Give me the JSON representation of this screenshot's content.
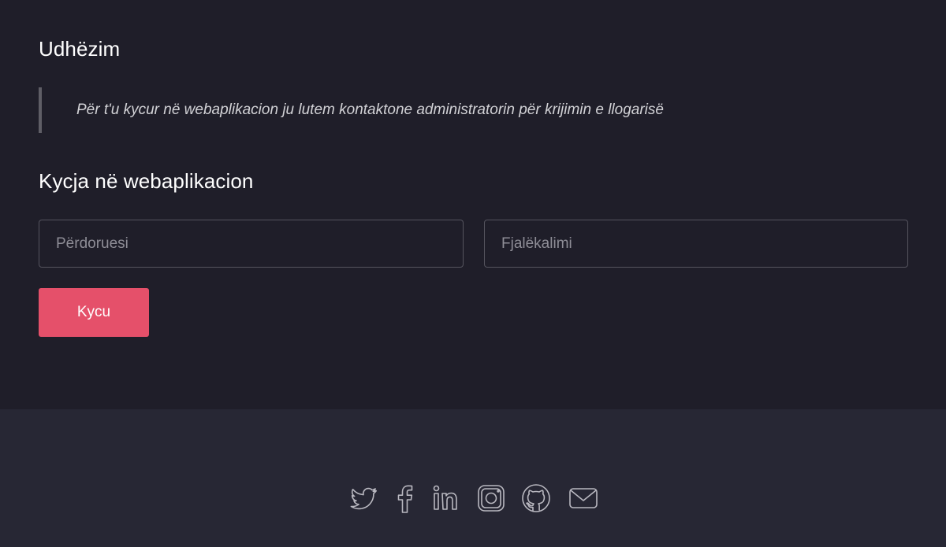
{
  "guide": {
    "title": "Udhëzim",
    "notice": "Për t'u kycur në webaplikacion ju lutem kontaktone administratorin për krijimin e llogarisë"
  },
  "login": {
    "title": "Kycja në webaplikacion",
    "username_placeholder": "Përdoruesi",
    "username_value": "",
    "password_placeholder": "Fjalëkalimi",
    "password_value": "",
    "submit_label": "Kycu"
  },
  "footer": {
    "social_icons": [
      "twitter-icon",
      "facebook-icon",
      "linkedin-icon",
      "instagram-icon",
      "github-icon",
      "mail-icon"
    ]
  },
  "colors": {
    "background": "#1f1e29",
    "footer_background": "#272734",
    "accent": "#e5506a",
    "icon": "#b9b8c0"
  }
}
